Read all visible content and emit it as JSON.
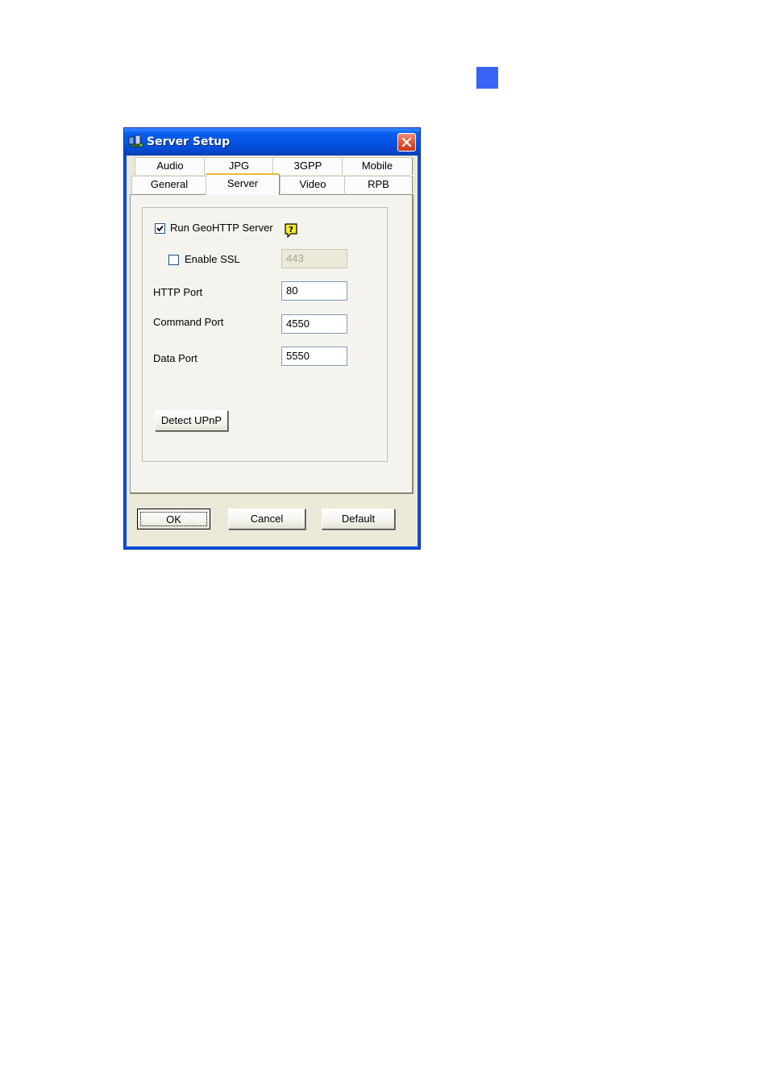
{
  "page_marker_color": "#3a63f5",
  "window": {
    "title": "Server Setup",
    "icon": "server-setup-app-icon",
    "close_icon": "close-icon"
  },
  "tabs": {
    "row1": [
      {
        "label": "Audio"
      },
      {
        "label": "JPG"
      },
      {
        "label": "3GPP"
      },
      {
        "label": "Mobile"
      }
    ],
    "row2": [
      {
        "label": "General"
      },
      {
        "label": "Server",
        "active": true
      },
      {
        "label": "Video"
      },
      {
        "label": "RPB"
      }
    ]
  },
  "server": {
    "run_geohttp_label": "Run GeoHTTP Server",
    "run_geohttp_checked": true,
    "help_icon": "help-question-icon",
    "enable_ssl_label": "Enable SSL",
    "enable_ssl_checked": false,
    "ssl_port_value": "443",
    "http_port_label": "HTTP Port",
    "http_port_value": "80",
    "command_port_label": "Command Port",
    "command_port_value": "4550",
    "data_port_label": "Data Port",
    "data_port_value": "5550",
    "detect_upnp_label": "Detect UPnP"
  },
  "buttons": {
    "ok": "OK",
    "cancel": "Cancel",
    "default": "Default"
  }
}
